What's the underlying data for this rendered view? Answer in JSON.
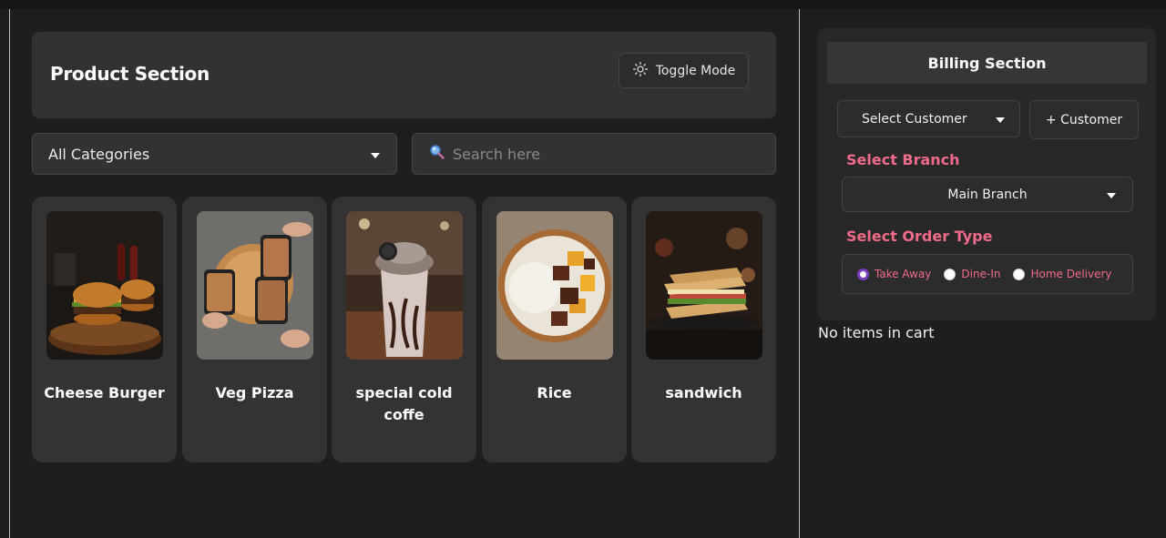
{
  "product_section": {
    "title": "Product Section",
    "toggle_label": "Toggle Mode",
    "toggle_icon": "sun-icon"
  },
  "filters": {
    "category_selected": "All Categories",
    "search_placeholder": "Search here",
    "search_icon": "magnifier-icon"
  },
  "products": [
    {
      "name": "Cheese Burger",
      "image": "burger-photo"
    },
    {
      "name": "Veg Pizza",
      "image": "pizza-photo"
    },
    {
      "name": "special cold coffe",
      "image": "cold-coffee-photo"
    },
    {
      "name": "Rice",
      "image": "rice-bowl-photo"
    },
    {
      "name": "sandwich",
      "image": "sandwich-photo"
    }
  ],
  "billing": {
    "title": "Billing Section",
    "select_customer_label": "Select Customer",
    "add_customer_label": "+ Customer",
    "branch_label": "Select Branch",
    "branch_selected": "Main Branch",
    "order_type_label": "Select Order Type",
    "order_types": [
      {
        "label": "Take Away",
        "checked": true
      },
      {
        "label": "Dine-In",
        "checked": false
      },
      {
        "label": "Home Delivery",
        "checked": false
      }
    ],
    "cart_empty_text": "No items in cart",
    "accent_color": "#f06b8a",
    "radio_checked_color": "#7b3fbf"
  }
}
